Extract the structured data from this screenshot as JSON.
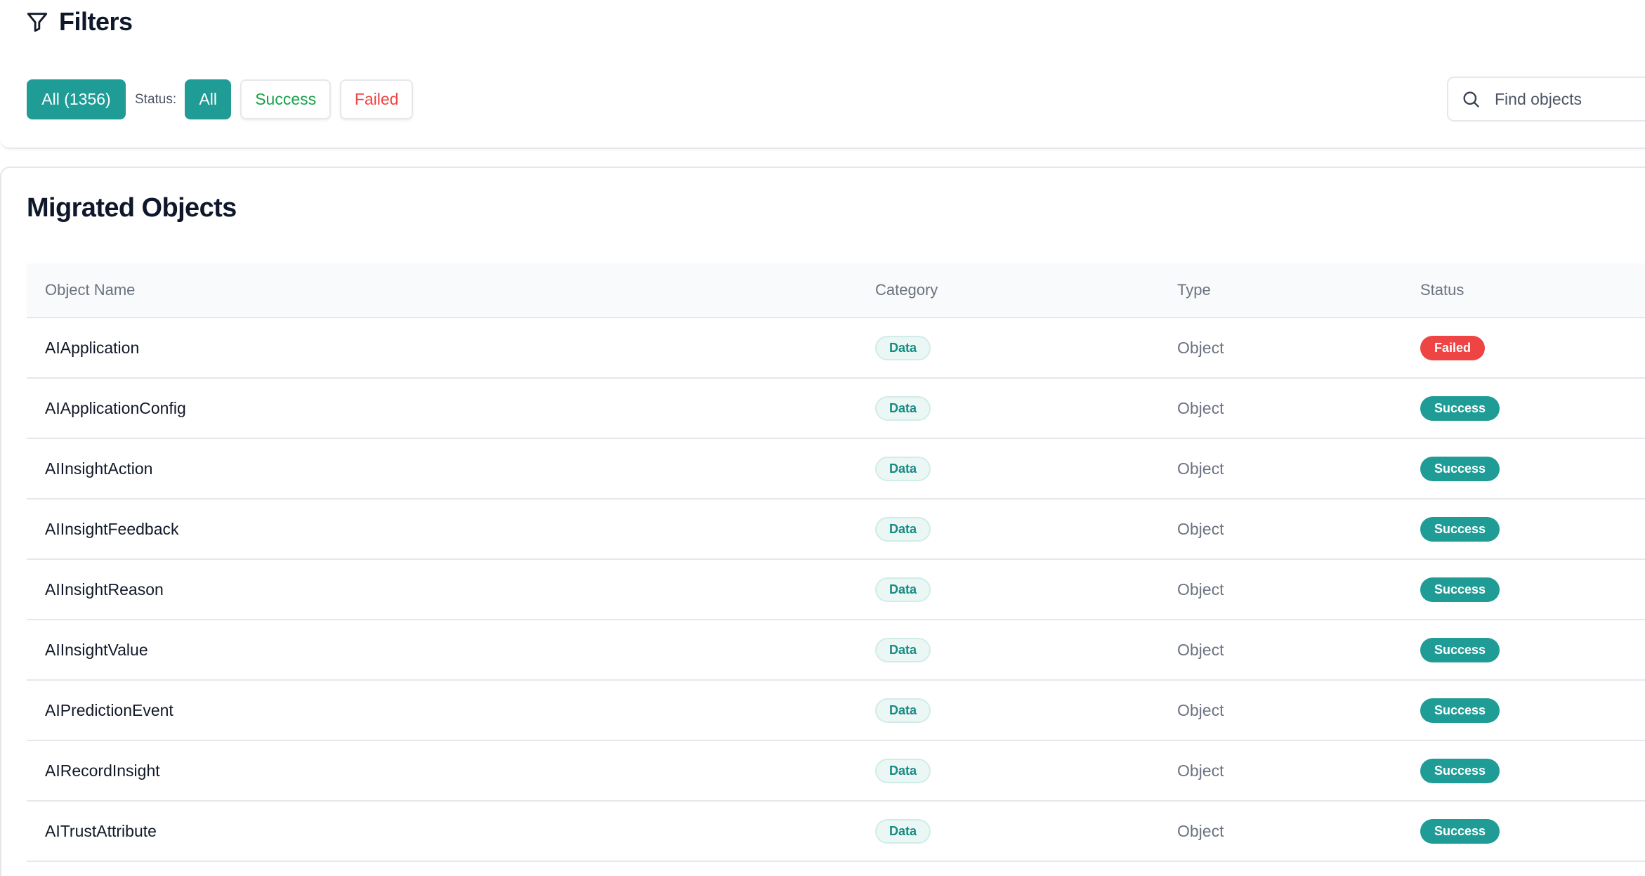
{
  "filters": {
    "title": "Filters",
    "all_count_label": "All (1356)",
    "status_label": "Status:",
    "status_options": {
      "all": "All",
      "success": "Success",
      "failed": "Failed"
    },
    "search_placeholder": "Find objects"
  },
  "objects": {
    "title": "Migrated Objects",
    "columns": {
      "name": "Object Name",
      "category": "Category",
      "type": "Type",
      "status": "Status"
    },
    "rows": [
      {
        "name": "AIApplication",
        "category": "Data",
        "type": "Object",
        "status": "Failed"
      },
      {
        "name": "AIApplicationConfig",
        "category": "Data",
        "type": "Object",
        "status": "Success"
      },
      {
        "name": "AIInsightAction",
        "category": "Data",
        "type": "Object",
        "status": "Success"
      },
      {
        "name": "AIInsightFeedback",
        "category": "Data",
        "type": "Object",
        "status": "Success"
      },
      {
        "name": "AIInsightReason",
        "category": "Data",
        "type": "Object",
        "status": "Success"
      },
      {
        "name": "AIInsightValue",
        "category": "Data",
        "type": "Object",
        "status": "Success"
      },
      {
        "name": "AIPredictionEvent",
        "category": "Data",
        "type": "Object",
        "status": "Success"
      },
      {
        "name": "AIRecordInsight",
        "category": "Data",
        "type": "Object",
        "status": "Success"
      },
      {
        "name": "AITrustAttribute",
        "category": "Data",
        "type": "Object",
        "status": "Success"
      }
    ]
  },
  "colors": {
    "primary": "#1f9c96",
    "success_text": "#16a34a",
    "failed": "#ef4444"
  },
  "icons": {
    "filter": "filter-funnel-icon",
    "search": "search-magnifier-icon"
  }
}
